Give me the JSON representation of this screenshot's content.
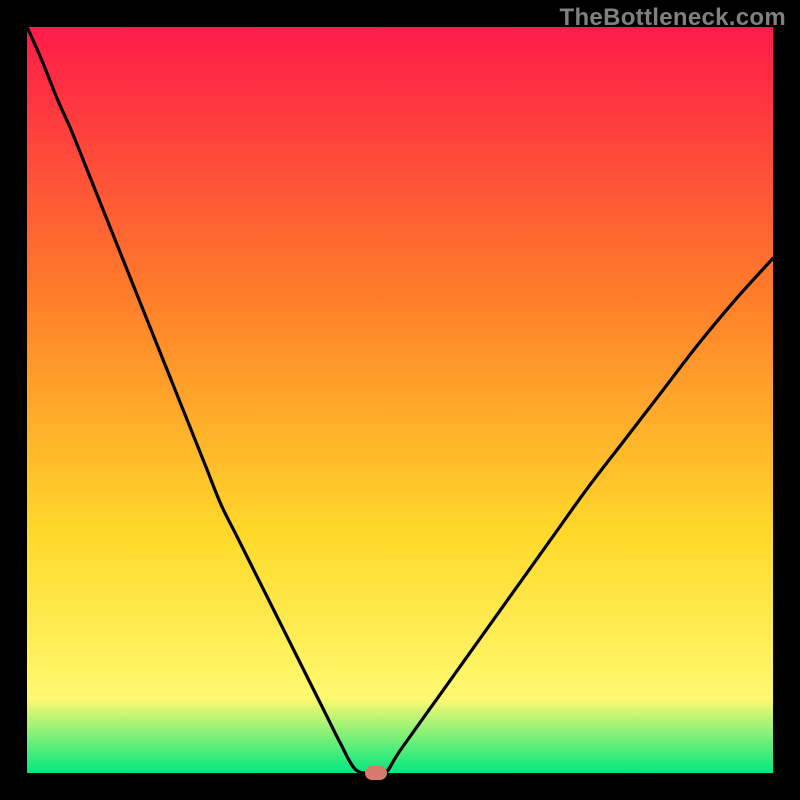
{
  "watermark": "TheBottleneck.com",
  "colors": {
    "background": "#000000",
    "gradient_top": "#ff1a4a",
    "gradient_mid1": "#ff7a2a",
    "gradient_mid2": "#ffd92a",
    "gradient_mid3": "#fff970",
    "gradient_bottom": "#00e880",
    "curve": "#000000",
    "marker": "#d67a6b",
    "watermark_text": "#808080"
  },
  "chart_data": {
    "type": "line",
    "title": "",
    "xlabel": "",
    "ylabel": "",
    "x": [
      0.0,
      0.02,
      0.04,
      0.06,
      0.08,
      0.1,
      0.12,
      0.14,
      0.16,
      0.18,
      0.2,
      0.22,
      0.24,
      0.26,
      0.28,
      0.3,
      0.32,
      0.34,
      0.36,
      0.38,
      0.4,
      0.42,
      0.44,
      0.46,
      0.48,
      0.5,
      0.55,
      0.6,
      0.65,
      0.7,
      0.75,
      0.8,
      0.85,
      0.9,
      0.95,
      1.0
    ],
    "values": [
      1.0,
      0.955,
      0.905,
      0.86,
      0.81,
      0.76,
      0.71,
      0.66,
      0.61,
      0.56,
      0.51,
      0.46,
      0.41,
      0.36,
      0.32,
      0.28,
      0.24,
      0.2,
      0.16,
      0.12,
      0.08,
      0.04,
      0.005,
      0.0,
      0.0,
      0.03,
      0.1,
      0.17,
      0.24,
      0.31,
      0.38,
      0.445,
      0.51,
      0.575,
      0.635,
      0.69
    ],
    "xlim": [
      0,
      1
    ],
    "ylim": [
      0,
      1
    ],
    "grid": false,
    "marker_point": {
      "x": 0.468,
      "y": 0.0
    },
    "notes": "V-shaped bottleneck curve over a vertical red-through-yellow-to-green gradient. Axes are unlabeled; values are normalized 0–1 fractions of the plot area."
  }
}
